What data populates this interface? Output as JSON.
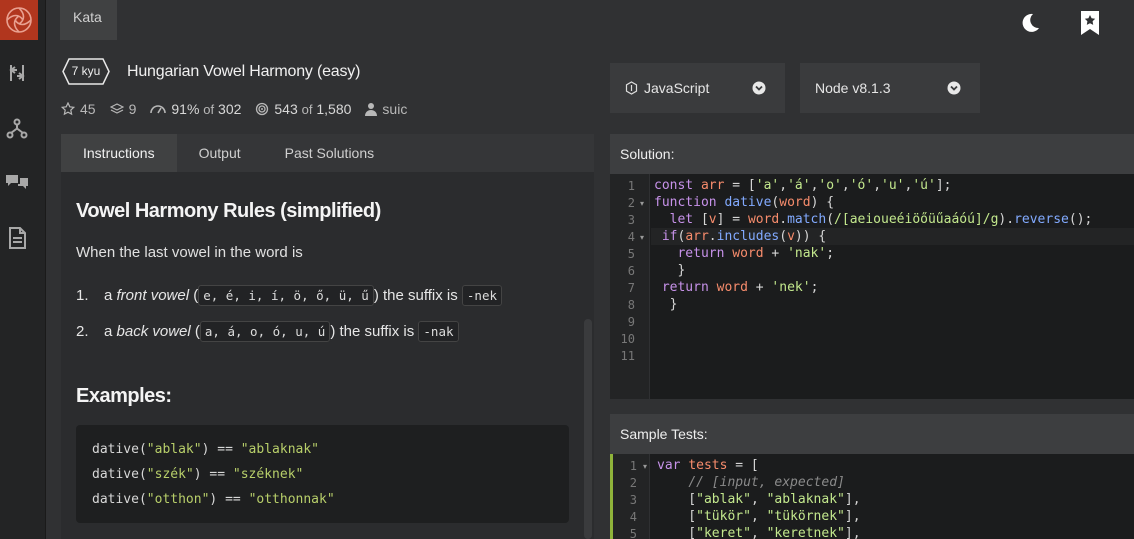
{
  "topbar": {
    "tab_label": "Kata"
  },
  "kata": {
    "rank": "7 kyu",
    "title": "Hungarian Vowel Harmony (easy)",
    "stars": "45",
    "collections": "9",
    "satisfaction_pct": "91%",
    "satisfaction_of": "of",
    "satisfaction_total": "302",
    "completed": "543",
    "completed_of": "of",
    "completed_total": "1,580",
    "author": "suic"
  },
  "language_dropdown": {
    "value": "JavaScript"
  },
  "version_dropdown": {
    "value": "Node v8.1.3"
  },
  "tabs": [
    {
      "label": "Instructions"
    },
    {
      "label": "Output"
    },
    {
      "label": "Past Solutions"
    }
  ],
  "instructions": {
    "heading": "Vowel Harmony Rules (simplified)",
    "intro": "When the last vowel in the word is",
    "rules": [
      {
        "num": "1.",
        "pre": "a ",
        "emph": "front vowel",
        "vowels": "e, é, i, í, ö, ő, ü, ű",
        "post": " the suffix is ",
        "suffix": "-nek"
      },
      {
        "num": "2.",
        "pre": "a ",
        "emph": "back vowel",
        "vowels": "a, á, o, ó, u, ú",
        "post": " the suffix is ",
        "suffix": "-nak"
      }
    ],
    "examples_heading": "Examples:",
    "examples": [
      {
        "call": "dative(",
        "arg": "\"ablak\"",
        "mid": ") == ",
        "result": "\"ablaknak\""
      },
      {
        "call": "dative(",
        "arg": "\"szék\"",
        "mid": ") == ",
        "result": "\"széknek\""
      },
      {
        "call": "dative(",
        "arg": "\"otthon\"",
        "mid": ") == ",
        "result": "\"otthonnak\""
      }
    ]
  },
  "solution": {
    "label": "Solution:",
    "line_numbers": [
      "1",
      "2",
      "3",
      "4",
      "5",
      "6",
      "7",
      "8",
      "9",
      "10",
      "11"
    ],
    "lines": [
      "const arr = ['a','á','o','ó','u','ú'];",
      "function dative(word) {",
      "  let [v] = word.match(/[aeioueéiöőüűaáóú]/g).reverse();",
      " if(arr.includes(v)) {",
      "   return word + 'nak';",
      "   }",
      " return word + 'nek';",
      "  }",
      "",
      "",
      ""
    ]
  },
  "sample_tests": {
    "label": "Sample Tests:",
    "line_numbers": [
      "1",
      "2",
      "3",
      "4",
      "5"
    ],
    "lines": [
      "var tests = [",
      "    // [input, expected]",
      "    [\"ablak\", \"ablaknak\"],",
      "    [\"tükör\", \"tükörnek\"],",
      "    [\"keret\", \"keretnek\"],"
    ]
  },
  "colors": {
    "logo_bg": "#b1361e",
    "accent_green": "#b8cf6a"
  }
}
